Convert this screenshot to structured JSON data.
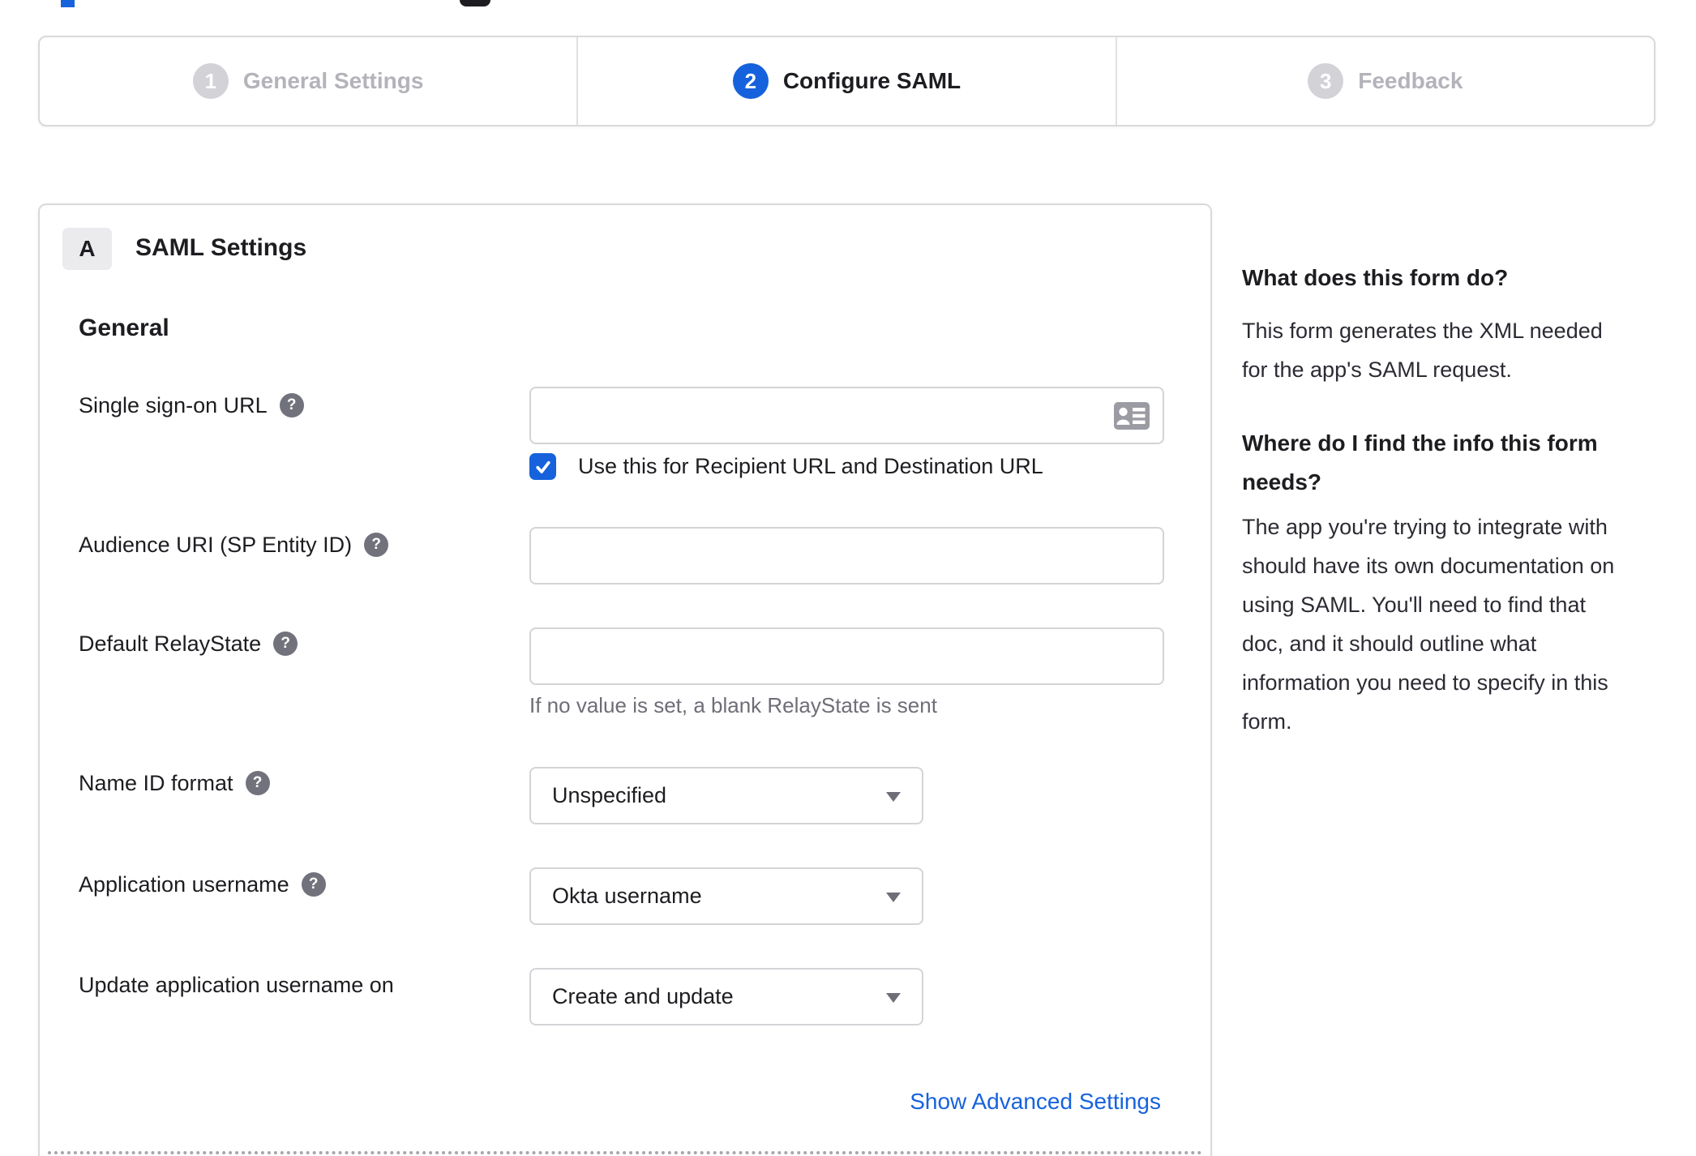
{
  "colors": {
    "accent_blue": "#1662dd",
    "text_dark": "#1d1d21",
    "text_muted": "#6e6e78",
    "inactive_gray": "#b3b3ba",
    "border_gray": "#d9d9dd"
  },
  "icons": {
    "help_glyph": "?"
  },
  "stepper": {
    "steps": [
      {
        "number": "1",
        "label": "General Settings",
        "state": "inactive"
      },
      {
        "number": "2",
        "label": "Configure SAML",
        "state": "active"
      },
      {
        "number": "3",
        "label": "Feedback",
        "state": "inactive"
      }
    ]
  },
  "panel": {
    "badge": "A",
    "title": "SAML Settings",
    "group_heading": "General",
    "fields": {
      "sso": {
        "label": "Single sign-on URL",
        "value": "",
        "has_help": true
      },
      "sso_checkbox": {
        "label": "Use this for Recipient URL and Destination URL",
        "checked": true
      },
      "audience": {
        "label": "Audience URI (SP Entity ID)",
        "value": "",
        "has_help": true
      },
      "relay": {
        "label": "Default RelayState",
        "value": "",
        "has_help": true,
        "hint": "If no value is set, a blank RelayState is sent"
      },
      "name_id": {
        "label": "Name ID format",
        "value": "Unspecified",
        "has_help": true
      },
      "app_username": {
        "label": "Application username",
        "value": "Okta username",
        "has_help": true
      },
      "update_username": {
        "label": "Update application username on",
        "value": "Create and update",
        "has_help": false
      }
    },
    "advanced_link": "Show Advanced Settings"
  },
  "sidebar": {
    "sections": [
      {
        "title": "What does this form do?",
        "title_lines": [
          "What does this form do?"
        ],
        "body": "This form generates the XML needed for the app's SAML request.",
        "body_lines": [
          "This form generates the XML needed",
          "for the app's SAML request."
        ]
      },
      {
        "title": "Where do I find the info this form needs?",
        "title_lines": [
          "Where do I find the info this form",
          "needs?"
        ],
        "body": "The app you're trying to integrate with should have its own documentation on using SAML. You'll need to find that doc, and it should outline what information you need to specify in this form.",
        "body_lines": [
          "The app you're trying to integrate with",
          "should have its own documentation on",
          "using SAML. You'll need to find that",
          "doc, and it should outline what",
          "information you need to specify in this",
          "form."
        ]
      }
    ]
  }
}
